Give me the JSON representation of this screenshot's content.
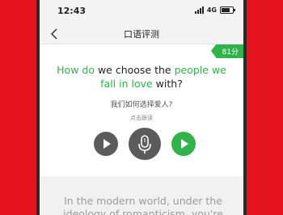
{
  "status_bar": {
    "time": "12:43",
    "network": "4G"
  },
  "header": {
    "title": "口语评测"
  },
  "score_badge": "81分",
  "sentence": {
    "parts": [
      {
        "text": "How do",
        "highlight": true
      },
      {
        "text": " we choose the ",
        "highlight": false
      },
      {
        "text": "people we fall in love",
        "highlight": true
      },
      {
        "text": " with?",
        "highlight": false
      }
    ]
  },
  "translation": "我们如何选择爱人?",
  "hint": "点击跟读",
  "paragraph": "In the modern world, under the ideology of romanticism, you're",
  "colors": {
    "accent": "#2fb34a",
    "brand": "#e5131e",
    "button": "#5b5b5b"
  },
  "icons": {
    "back": "chevron-left-icon",
    "play": "play-icon",
    "mic": "microphone-icon"
  }
}
